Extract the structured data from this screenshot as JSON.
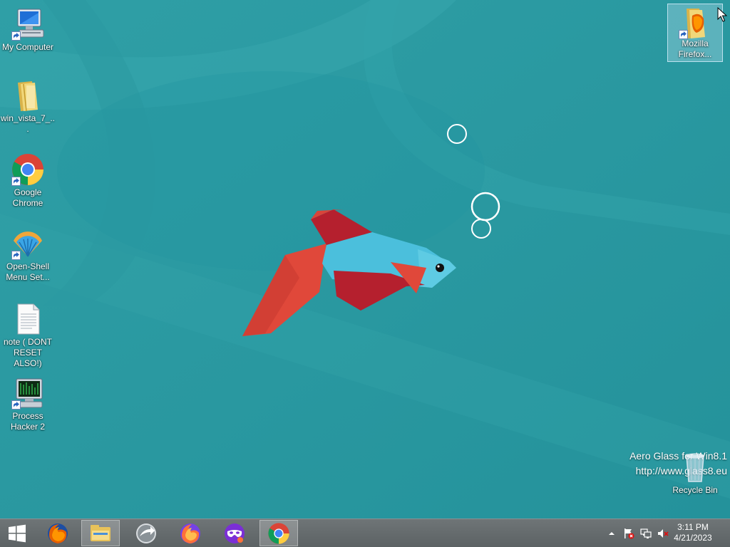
{
  "desktop": {
    "icons": [
      {
        "label": "My Computer",
        "icon": "computer-icon"
      },
      {
        "label": "win_vista_7_...",
        "icon": "folder-icon"
      },
      {
        "label": "Google Chrome",
        "icon": "chrome-icon"
      },
      {
        "label": "Open-Shell Menu Set...",
        "icon": "open-shell-icon"
      },
      {
        "label": "note ( DONT RESET ALSO!)",
        "icon": "text-document-icon"
      },
      {
        "label": "Process Hacker 2",
        "icon": "process-hacker-icon"
      },
      {
        "label": "Mozilla Firefox...",
        "icon": "firefox-folder-icon"
      },
      {
        "label": "Recycle Bin",
        "icon": "recycle-bin-icon"
      }
    ],
    "watermark": {
      "line1": "Aero Glass for Win8.1",
      "line2": "http://www.glass8.eu"
    }
  },
  "taskbar": {
    "buttons": [
      {
        "icon": "windows-start-icon",
        "active": false
      },
      {
        "icon": "firefox-icon",
        "active": false
      },
      {
        "icon": "file-explorer-icon",
        "active": true
      },
      {
        "icon": "migration-app-icon",
        "active": false
      },
      {
        "icon": "firefox-nightly-icon",
        "active": false
      },
      {
        "icon": "mask-app-icon",
        "active": false
      },
      {
        "icon": "chrome-icon",
        "active": true
      }
    ],
    "tray": {
      "icons": [
        "show-hidden-icons-chevron",
        "action-center-flag-icon",
        "network-icon",
        "volume-muted-icon"
      ],
      "time": "3:11 PM",
      "date": "4/21/2023"
    }
  },
  "colors": {
    "wallpaper": "#2a98a0",
    "taskbar": "#666c6e",
    "fish_blue": "#4bbfdc",
    "fish_red": "#b5202e",
    "fish_orange": "#e0483a"
  }
}
